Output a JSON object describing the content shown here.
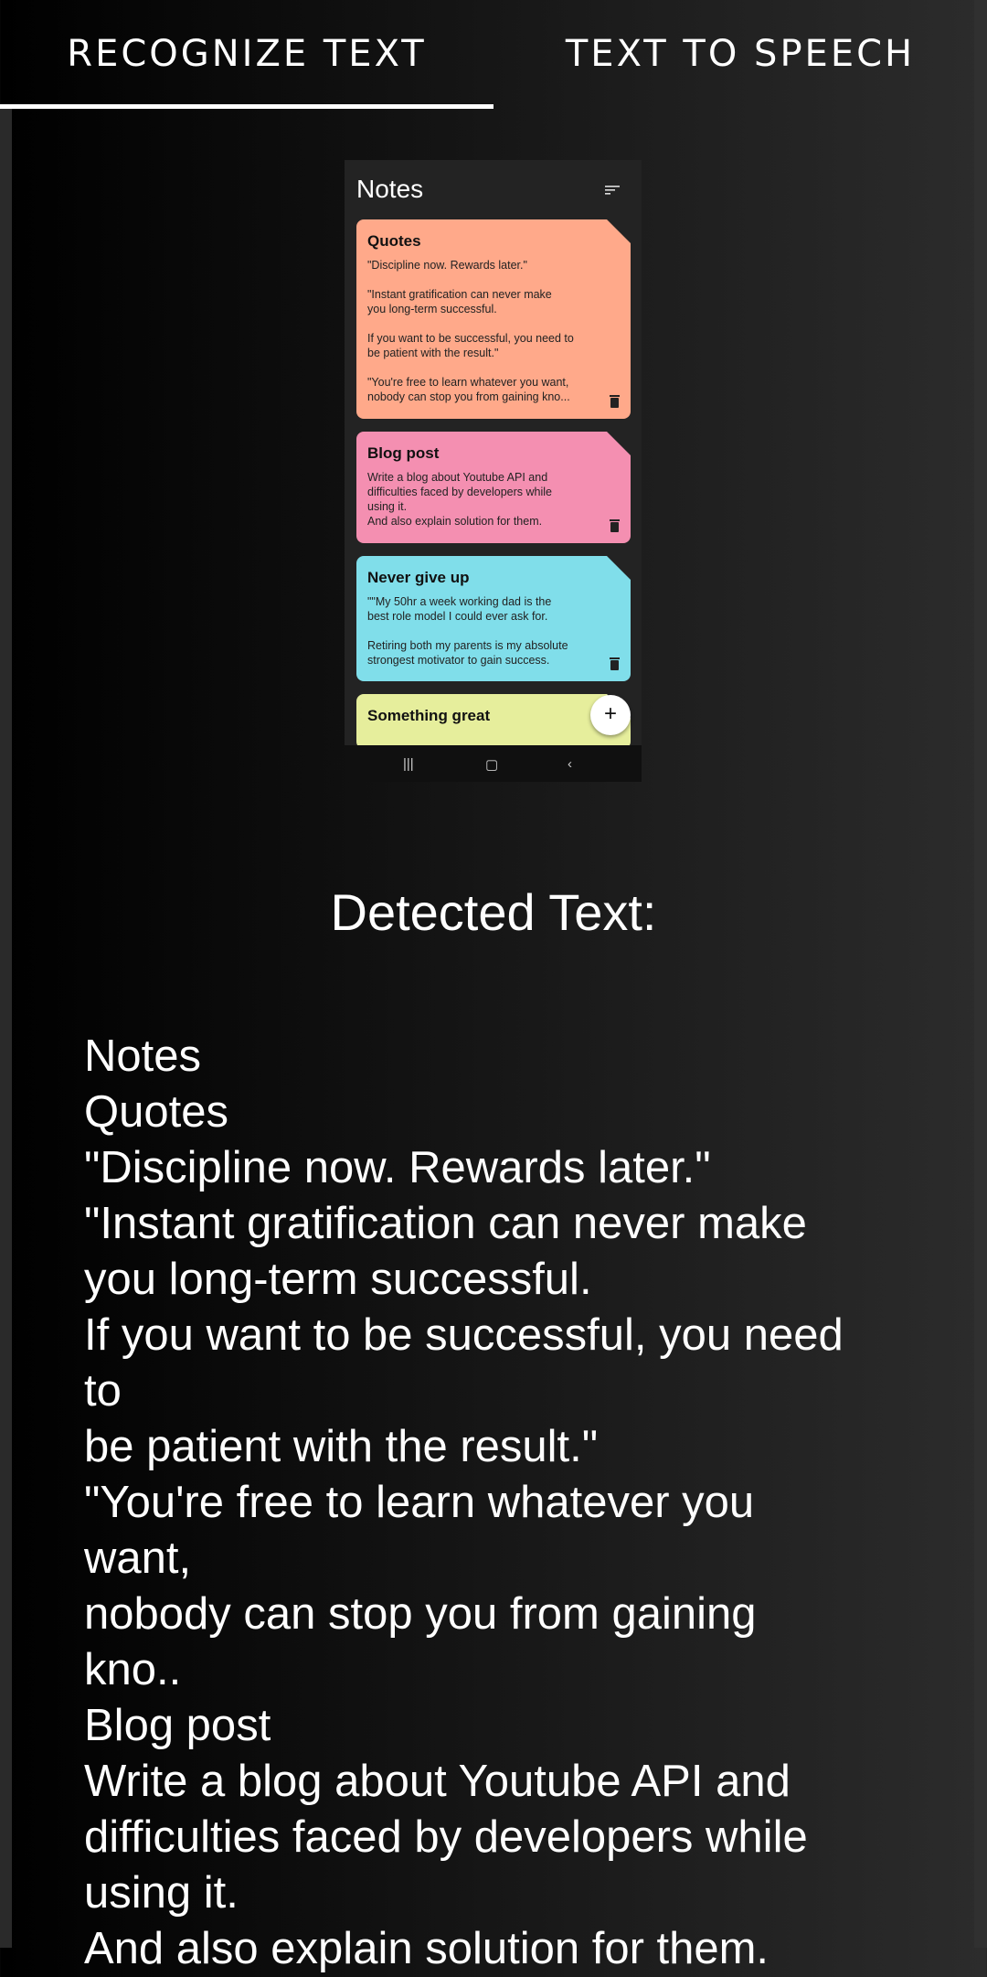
{
  "tabs": [
    {
      "label": "RECOGNIZE TEXT",
      "selected": true
    },
    {
      "label": "TEXT TO SPEECH",
      "selected": false
    }
  ],
  "screenshot": {
    "header": "Notes",
    "notes": [
      {
        "title": "Quotes",
        "body": " \"Discipline now. Rewards later.\"\n\n \"Instant gratification can never make\nyou long-term successful.\n\nIf you want to be successful, you need to\nbe patient with the result.\"\n\n\"You're free to learn whatever you want,\nnobody can stop you from gaining kno...",
        "color": "#ffa98a"
      },
      {
        "title": "Blog post",
        "body": "Write a blog about Youtube API and\ndifficulties faced by developers while\nusing it.\nAnd also explain solution for them.",
        "color": "#f48fb1"
      },
      {
        "title": "Never give up",
        "body": "\"\"My 50hr a week working dad is the\nbest role model I could ever ask for.\n\nRetiring both my parents is my absolute\nstrongest motivator to gain success.",
        "color": "#80deea"
      },
      {
        "title": "Something great",
        "body": "",
        "color": "#e6ee9c"
      }
    ],
    "fab_label": "+"
  },
  "detected": {
    "title": "Detected Text:",
    "text": "Notes\nQuotes\n\"Discipline now. Rewards later.\"\n\"Instant gratification can never make\nyou long-term successful.\nIf you want to be successful, you need\nto\nbe patient with the result.\"\n\"You're free to learn whatever you\nwant,\nnobody can stop you from gaining\nkno..\nBlog post\nWrite a blog about Youtube API and\ndifficulties faced by developers while\nusing it.\nAnd also explain solution for them."
  }
}
